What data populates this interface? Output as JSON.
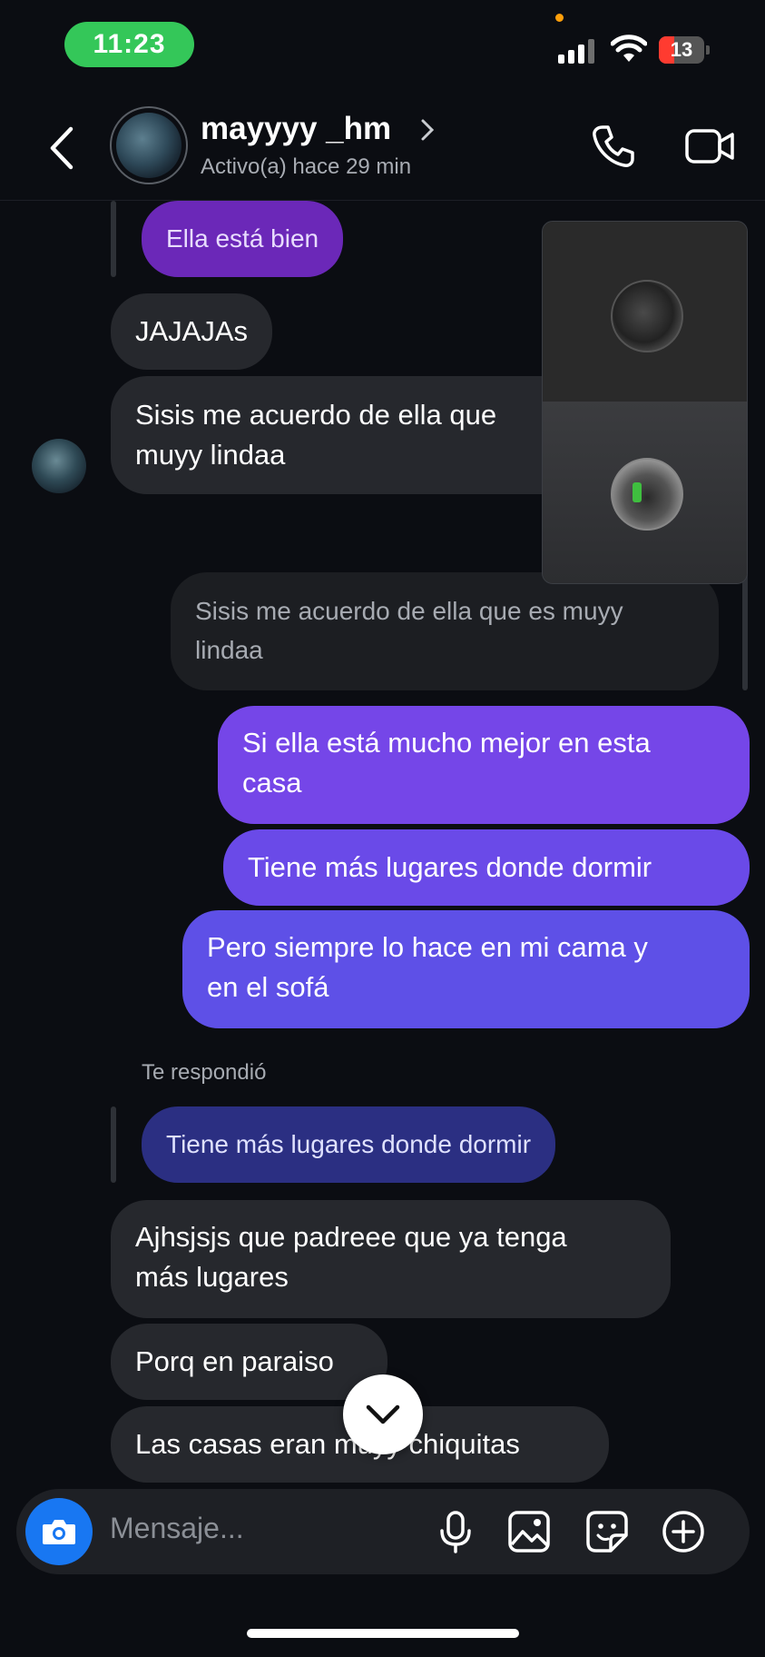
{
  "status_bar": {
    "time": "11:23",
    "battery": "13",
    "colors": {
      "time_pill": "#34c759",
      "battery_fill": "#ff3b30",
      "privacy_dot": "#ff9f0a"
    }
  },
  "header": {
    "username": "mayyyy _hm",
    "status": "Activo(a) hace 29 min",
    "icons": [
      "back-chevron-icon",
      "chevron-right-icon",
      "phone-icon",
      "video-camera-icon"
    ]
  },
  "messages": {
    "reply1_quoted": "Ella está bien",
    "m1": "JAJAJAs",
    "m2_line1": "Sisis me acuerdo de ella que",
    "m2_line2": "muyy lindaa",
    "quoted_line1": "Sisis me acuerdo de ella que es muyy",
    "quoted_line2": "lindaa",
    "out1_line1": "Si ella está mucho mejor en esta",
    "out1_line2": "casa",
    "out2": "Tiene más lugares donde dormir",
    "out3_line1": "Pero siempre lo hace en mi cama y",
    "out3_line2": "en el sofá",
    "replied_label": "Te respondió",
    "reply2_quoted": "Tiene más lugares donde dormir",
    "in3_line1": "Ajhsjsjs que padreee que ya tenga",
    "in3_line2": "más lugares",
    "in4": "Porq en paraiso",
    "in5": "Las casas eran muyy chiquitas"
  },
  "composer": {
    "placeholder": "Mensaje...",
    "icons": [
      "camera-icon",
      "microphone-icon",
      "gallery-icon",
      "sticker-icon",
      "plus-icon"
    ],
    "accent": "#1877f2"
  },
  "colors": {
    "background": "#0b0d12",
    "incoming_bubble": "#26282d",
    "outgoing_gradient": [
      "#7a45e6",
      "#5a52e6"
    ]
  }
}
